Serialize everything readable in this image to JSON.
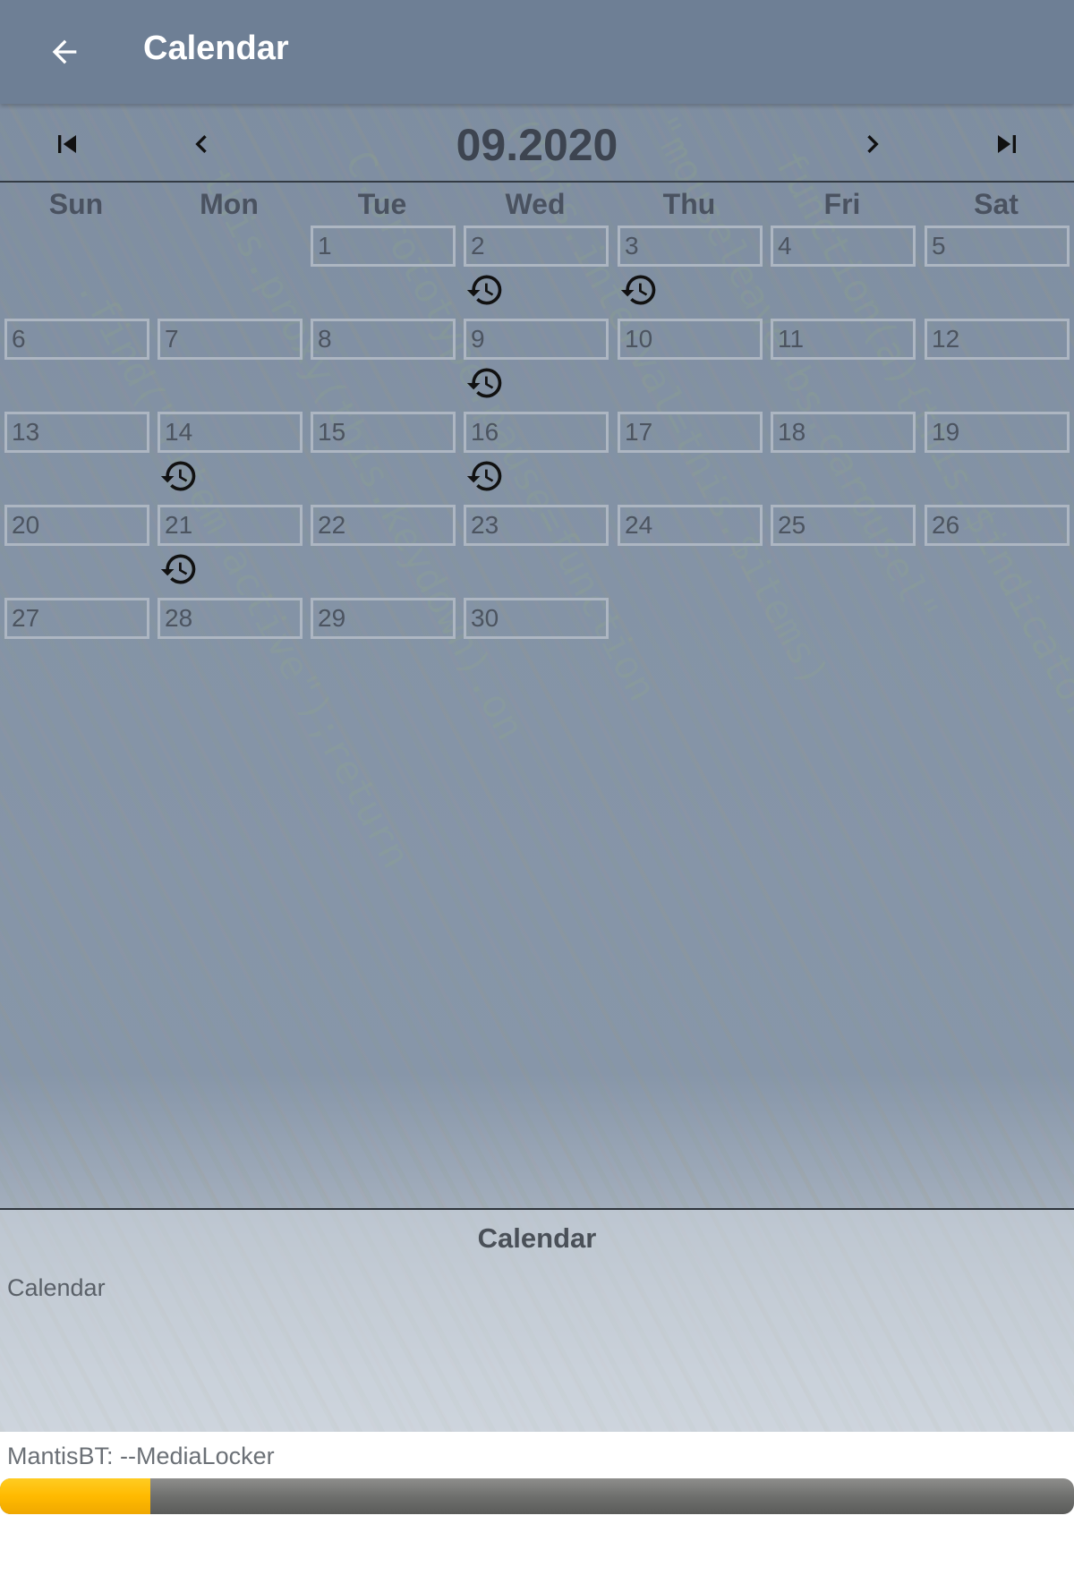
{
  "appbar": {
    "title": "Calendar",
    "back_icon": "arrow-left-icon"
  },
  "month_nav": {
    "label": "09.2020",
    "first_icon": "skip-first-icon",
    "prev_icon": "chevron-left-icon",
    "next_icon": "chevron-right-icon",
    "last_icon": "skip-last-icon"
  },
  "weekdays": [
    "Sun",
    "Mon",
    "Tue",
    "Wed",
    "Thu",
    "Fri",
    "Sat"
  ],
  "calendar": {
    "first_weekday_index": 2,
    "days_in_month": 30,
    "days": [
      "1",
      "2",
      "3",
      "4",
      "5",
      "6",
      "7",
      "8",
      "9",
      "10",
      "11",
      "12",
      "13",
      "14",
      "15",
      "16",
      "17",
      "18",
      "19",
      "20",
      "21",
      "22",
      "23",
      "24",
      "25",
      "26",
      "27",
      "28",
      "29",
      "30"
    ],
    "event_days": [
      2,
      3,
      9,
      14,
      16,
      21
    ],
    "event_icon": "clock-history-icon"
  },
  "info_panel": {
    "title": "Calendar",
    "text": "Calendar"
  },
  "status": {
    "text": "MantisBT: --MediaLocker"
  },
  "progress": {
    "value": 0.14,
    "fill_color": "#ffbb00",
    "track_color": "#6f706e"
  }
}
